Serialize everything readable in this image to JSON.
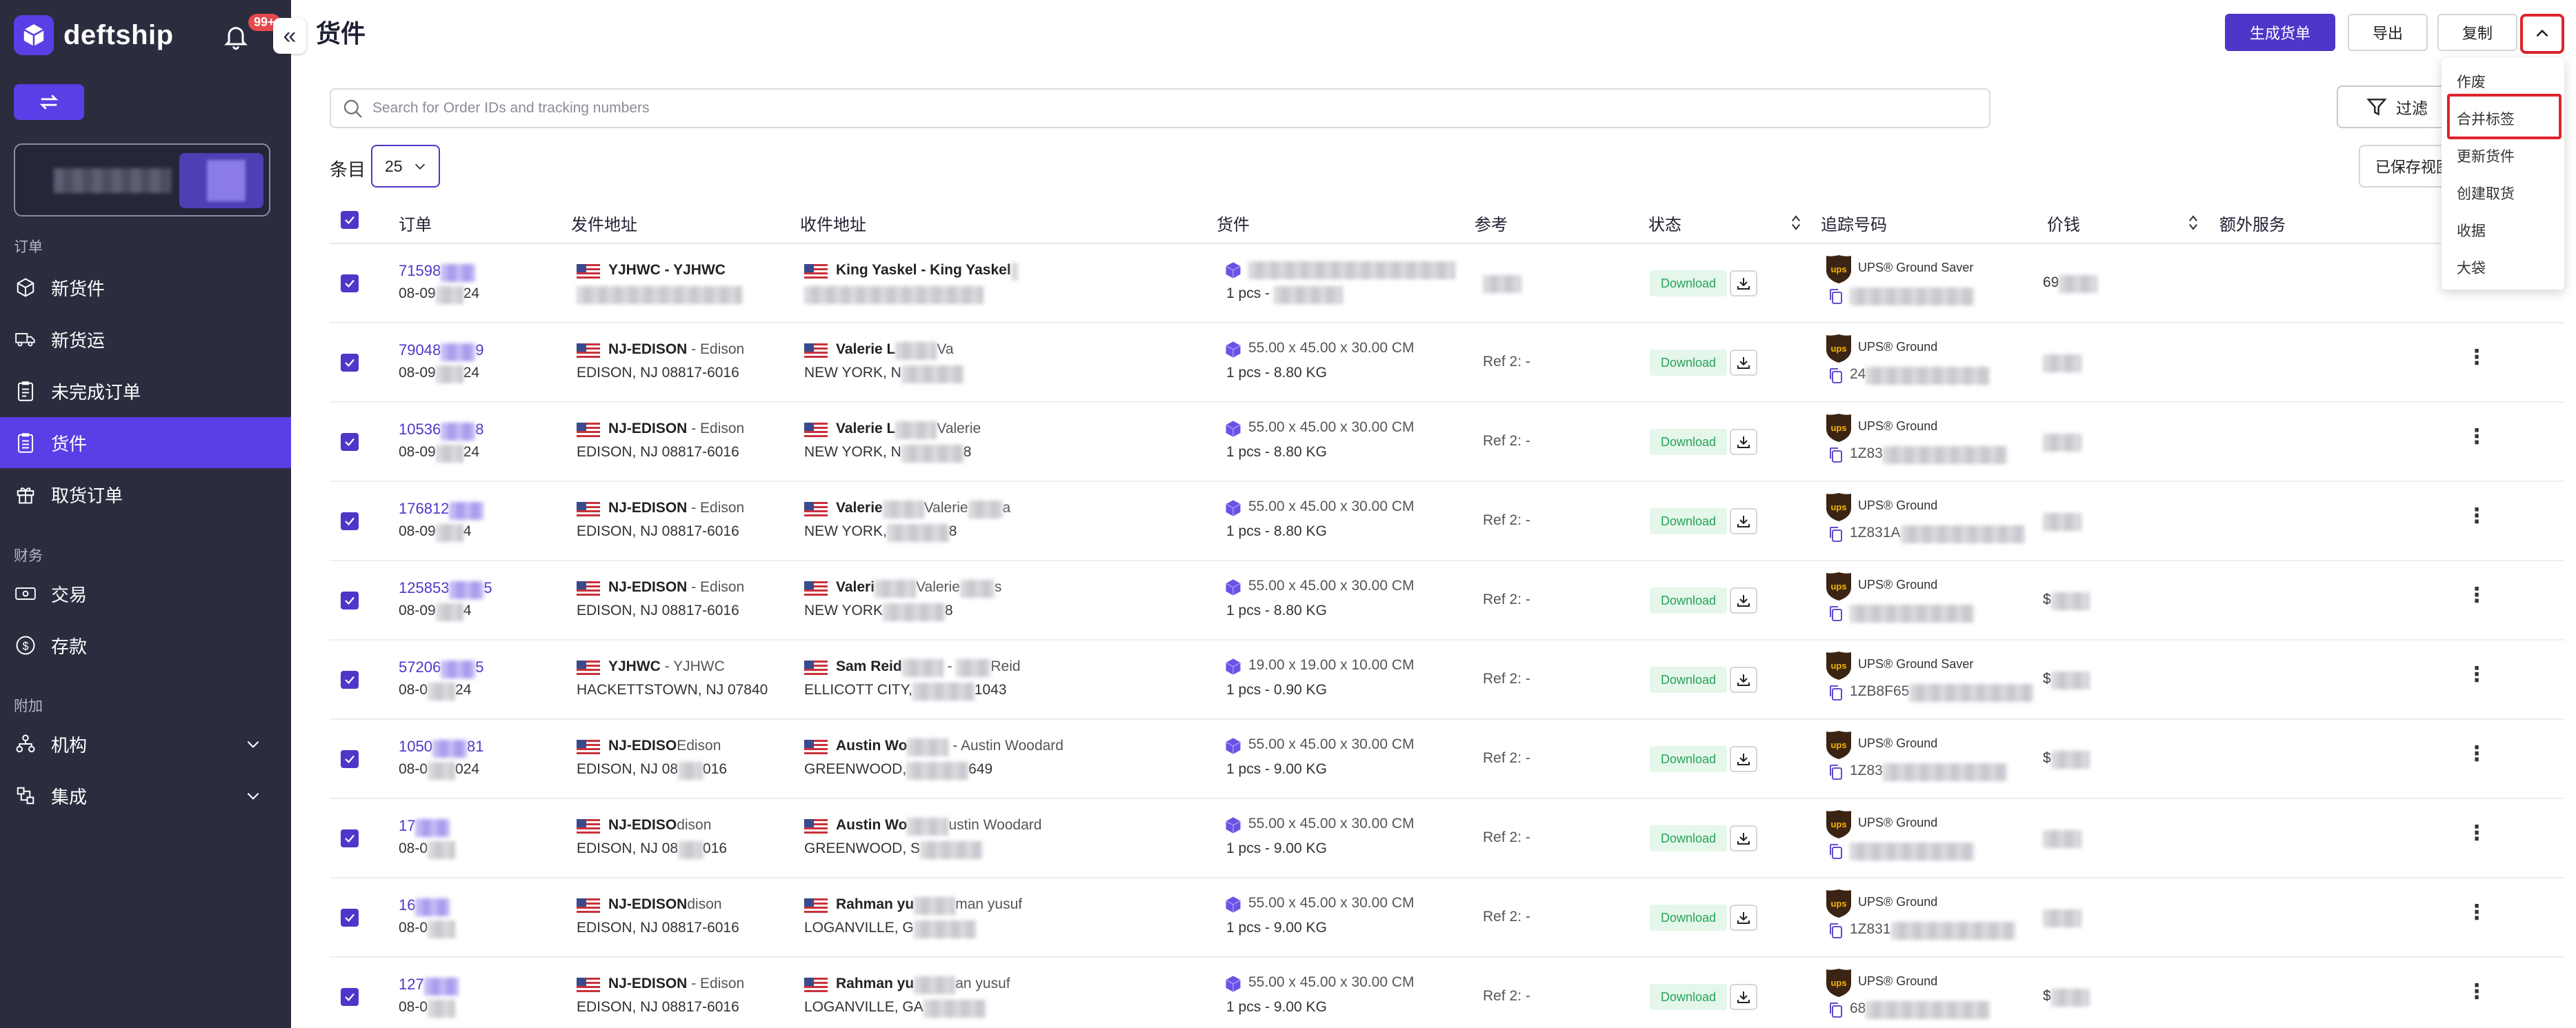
{
  "brand": {
    "name": "deftship",
    "notification_badge": "99+"
  },
  "sidebar": {
    "sections": [
      {
        "label": "订单",
        "items": [
          {
            "label": "新货件",
            "icon": "cube-icon"
          },
          {
            "label": "新货运",
            "icon": "truck-icon"
          },
          {
            "label": "未完成订单",
            "icon": "clipboard-icon"
          },
          {
            "label": "货件",
            "icon": "clipboard-list-icon",
            "active": true
          },
          {
            "label": "取货订单",
            "icon": "gift-icon"
          }
        ]
      },
      {
        "label": "财务",
        "items": [
          {
            "label": "交易",
            "icon": "money-icon"
          },
          {
            "label": "存款",
            "icon": "dollar-circle-icon"
          }
        ]
      },
      {
        "label": "附加",
        "items": [
          {
            "label": "机构",
            "icon": "org-icon"
          },
          {
            "label": "集成",
            "icon": "integration-icon"
          }
        ]
      }
    ]
  },
  "header": {
    "title": "货件",
    "buttons": {
      "create_manifest": "生成货单",
      "export": "导出",
      "copy": "复制"
    }
  },
  "search": {
    "placeholder": "Search for Order IDs and tracking numbers"
  },
  "filter": {
    "label": "过滤"
  },
  "entries": {
    "label": "条目",
    "value": "25"
  },
  "saved_view": {
    "label": "已保存视图"
  },
  "table": {
    "headers": {
      "order": "订单",
      "from": "发件地址",
      "to": "收件地址",
      "shipment": "货件",
      "reference": "参考",
      "status": "状态",
      "tracking": "追踪号码",
      "price": "价钱",
      "extra": "额外服务"
    },
    "rows": [
      {
        "order_id": "71598",
        "date": "08-09",
        "date_tail": "24",
        "from_name": "YJHWC - YJHWC",
        "from_addr": "",
        "to_name": "King Yaskel - King Yaskel",
        "to_addr": "",
        "dims": "",
        "weight": "1 pcs - ",
        "ref": "",
        "status": "Download",
        "service": "UPS® Ground Saver",
        "tracking": "",
        "price": "69"
      },
      {
        "order_id": "79048",
        "order_tail": "9",
        "date": "08-09",
        "date_tail": "24",
        "from_name": "NJ-EDISON",
        "from_sub": " - Edison",
        "from_addr": "EDISON, NJ 08817-6016",
        "to_name": "Valerie L",
        "to_sub": "Va",
        "to_addr": "NEW YORK, N",
        "dims": "55.00 x 45.00 x 30.00 CM",
        "weight": "1 pcs - 8.80 KG",
        "ref": "Ref 2: -",
        "status": "Download",
        "service": "UPS® Ground",
        "tracking": "24",
        "price": ""
      },
      {
        "order_id": "10536",
        "order_tail": "8",
        "date": "08-09",
        "date_tail": "24",
        "from_name": "NJ-EDISON",
        "from_sub": " - Edison",
        "from_addr": "EDISON, NJ 08817-6016",
        "to_name": "Valerie L",
        "to_sub": "Valerie",
        "to_addr": "NEW YORK, N",
        "to_tail": "8",
        "dims": "55.00 x 45.00 x 30.00 CM",
        "weight": "1 pcs - 8.80 KG",
        "ref": "Ref 2: -",
        "status": "Download",
        "service": "UPS® Ground",
        "tracking": "1Z83",
        "price": ""
      },
      {
        "order_id": "176812",
        "order_tail": "",
        "date": "08-09",
        "date_tail": "4",
        "from_name": "NJ-EDISON",
        "from_sub": " - Edison",
        "from_addr": "EDISON, NJ 08817-6016",
        "to_name": "Valerie",
        "to_sub": "Valerie",
        "to_sub_tail": "a",
        "to_addr": "NEW YORK,",
        "to_tail": "8",
        "dims": "55.00 x 45.00 x 30.00 CM",
        "weight": "1 pcs - 8.80 KG",
        "ref": "Ref 2: -",
        "status": "Download",
        "service": "UPS® Ground",
        "tracking": "1Z831A",
        "price": ""
      },
      {
        "order_id": "125853",
        "order_tail": "5",
        "date": "08-09",
        "date_tail": "4",
        "from_name": "NJ-EDISON",
        "from_sub": " - Edison",
        "from_addr": "EDISON, NJ 08817-6016",
        "to_name": "Valeri",
        "to_sub": "Valerie",
        "to_sub_tail": "s",
        "to_addr": "NEW YORK",
        "to_tail": "8",
        "dims": "55.00 x 45.00 x 30.00 CM",
        "weight": "1 pcs - 8.80 KG",
        "ref": "Ref 2: -",
        "status": "Download",
        "service": "UPS® Ground",
        "tracking": "",
        "price": "$"
      },
      {
        "order_id": "57206",
        "order_tail": "5",
        "date": "08-0",
        "date_tail": "24",
        "from_name": "YJHWC",
        "from_sub": " - YJHWC",
        "from_addr": "HACKETTSTOWN, NJ 07840",
        "to_name": "Sam Reid",
        "to_sub": " - ",
        "to_sub_tail": "Reid",
        "to_addr": "ELLICOTT CITY,",
        "to_tail": "1043",
        "dims": "19.00 x 19.00 x 10.00 CM",
        "weight": "1 pcs - 0.90 KG",
        "ref": "Ref 2: -",
        "status": "Download",
        "service": "UPS® Ground Saver",
        "tracking": "1ZB8F65",
        "price": "$"
      },
      {
        "order_id": "1050",
        "order_tail": "81",
        "date": "08-0",
        "date_tail": "024",
        "from_name": "NJ-EDISO",
        "from_sub": "Edison",
        "from_addr": "EDISON, NJ 08",
        "from_addr_tail": "016",
        "to_name": "Austin Wo",
        "to_sub": " - Austin Woodard",
        "to_addr": "GREENWOOD,",
        "to_tail": "649",
        "dims": "55.00 x 45.00 x 30.00 CM",
        "weight": "1 pcs - 9.00 KG",
        "ref": "Ref 2: -",
        "status": "Download",
        "service": "UPS® Ground",
        "tracking": "1Z83",
        "price": "$"
      },
      {
        "order_id": "17",
        "order_tail": "",
        "date": "08-0",
        "date_tail": "",
        "from_name": "NJ-EDISO",
        "from_sub": "dison",
        "from_addr": "EDISON, NJ 08",
        "from_addr_tail": "016",
        "to_name": "Austin Wo",
        "to_sub": "ustin Woodard",
        "to_addr": "GREENWOOD, S",
        "to_tail": "",
        "dims": "55.00 x 45.00 x 30.00 CM",
        "weight": "1 pcs - 9.00 KG",
        "ref": "Ref 2: -",
        "status": "Download",
        "service": "UPS® Ground",
        "tracking": "",
        "price": ""
      },
      {
        "order_id": "16",
        "order_tail": "",
        "date": "08-0",
        "date_tail": "",
        "from_name": "NJ-EDISON",
        "from_sub": "dison",
        "from_addr": "EDISON, NJ 08817-6016",
        "to_name": "Rahman yu",
        "to_sub": "man yusuf",
        "to_addr": "LOGANVILLE, G",
        "to_tail": "",
        "dims": "55.00 x 45.00 x 30.00 CM",
        "weight": "1 pcs - 9.00 KG",
        "ref": "Ref 2: -",
        "status": "Download",
        "service": "UPS® Ground",
        "tracking": "1Z831",
        "price": ""
      },
      {
        "order_id": "127",
        "order_tail": "",
        "date": "08-0",
        "date_tail": "",
        "from_name": "NJ-EDISON",
        "from_sub": " - Edison",
        "from_addr": "EDISON, NJ 08817-6016",
        "to_name": "Rahman yu",
        "to_sub": "an yusuf",
        "to_addr": "LOGANVILLE, GA",
        "to_tail": "",
        "dims": "55.00 x 45.00 x 30.00 CM",
        "weight": "1 pcs - 9.00 KG",
        "ref": "Ref 2: -",
        "status": "Download",
        "service": "UPS® Ground",
        "tracking": "68",
        "price": "$"
      }
    ]
  },
  "dropdown": {
    "items": [
      "作废",
      "合并标签",
      "更新货件",
      "创建取货",
      "收据",
      "大袋"
    ],
    "highlighted": "合并标签"
  },
  "colors": {
    "brand": "#5a3ee6",
    "sidebar_bg": "#2b2d3f",
    "primary_button": "#4f36c9",
    "download_bg": "#e5f6ea",
    "download_text": "#27a35a",
    "highlight_red": "#e0232b",
    "ups_brown": "#3b2413",
    "ups_gold": "#f5b400"
  }
}
